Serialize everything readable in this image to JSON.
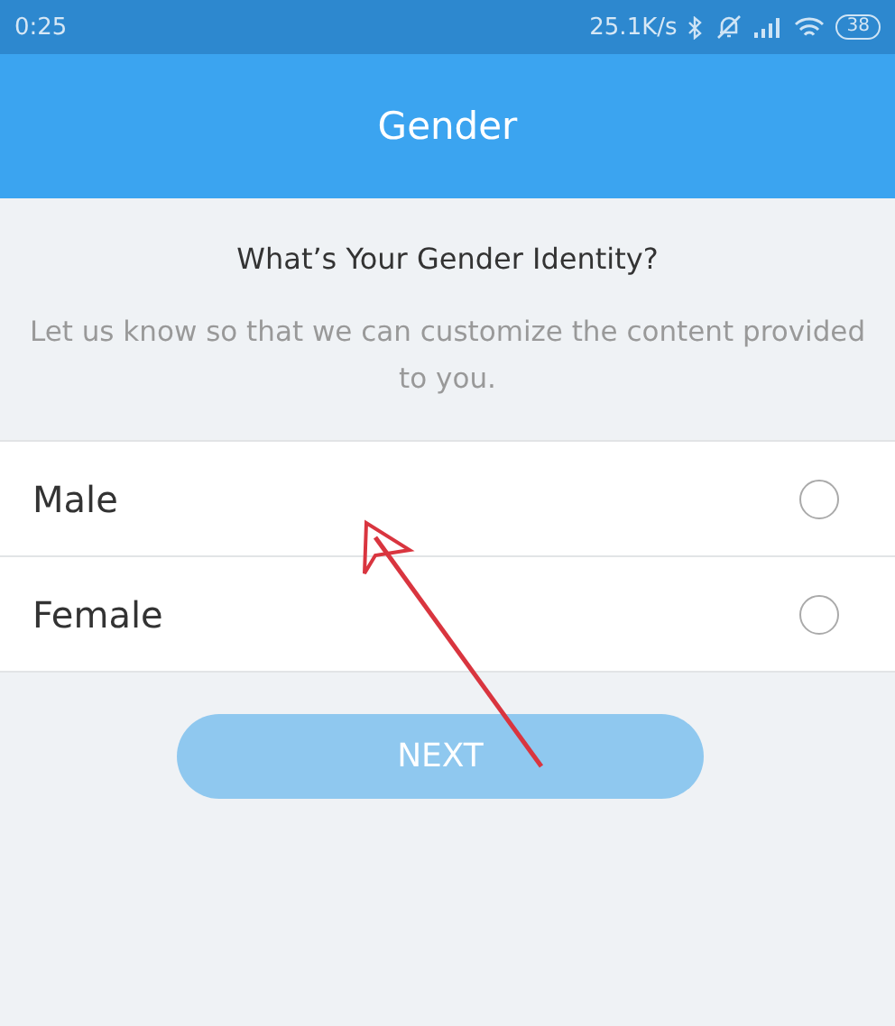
{
  "status_bar": {
    "time": "0:25",
    "speed": "25.1K/s",
    "battery": "38"
  },
  "header": {
    "title": "Gender"
  },
  "question": {
    "title": "What’s Your Gender Identity?",
    "description": "Let us know so that we can customize the content provided to you."
  },
  "options": [
    {
      "label": "Male",
      "selected": false
    },
    {
      "label": "Female",
      "selected": false
    }
  ],
  "next_button": {
    "label": "NEXT",
    "disabled": true
  },
  "annotation": {
    "kind": "arrow"
  }
}
